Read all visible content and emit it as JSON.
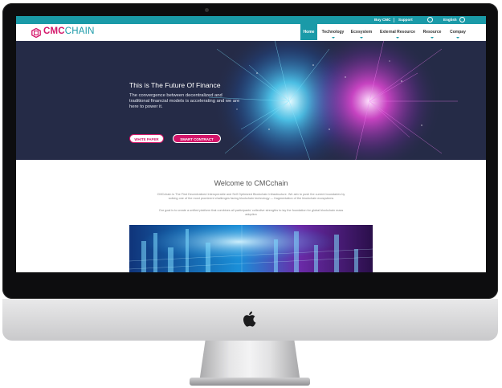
{
  "topbar": {
    "buy_label": "Buy CMC",
    "support_label": "Support",
    "language_label": "English"
  },
  "brand": {
    "part1": "CMC",
    "part2": "CHAIN",
    "colors": {
      "pink": "#d31569",
      "teal": "#1a9aa8",
      "navy": "#252b47"
    }
  },
  "nav": {
    "items": [
      {
        "label": "Home",
        "active": true
      },
      {
        "label": "Technology"
      },
      {
        "label": "Ecosystem"
      },
      {
        "label": "External Resource"
      },
      {
        "label": "Resource"
      },
      {
        "label": "Compay"
      }
    ]
  },
  "hero": {
    "title": "This is The Future Of Finance",
    "subtitle": "The convergence between decentralized and traditional financial models is accelerating and we are here to power it.",
    "btn_whitepaper": "WHITE PAPER",
    "btn_contract": "SMART CONTRACT"
  },
  "welcome": {
    "title": "Welcome to CMCchain",
    "para1": "CMCchain is The First Decentralized Interoperable and Self Optimized Blockchain Infrastructure. We aim to push the current boundaries by solving one of the most prominent challenges facing blockchain technology — fragmentation of the blockchain ecosystems",
    "para2": "Our goal is to create a unified platform that combines all participants' collective strengths to lay the foundation for global blockchain mass adoption"
  }
}
